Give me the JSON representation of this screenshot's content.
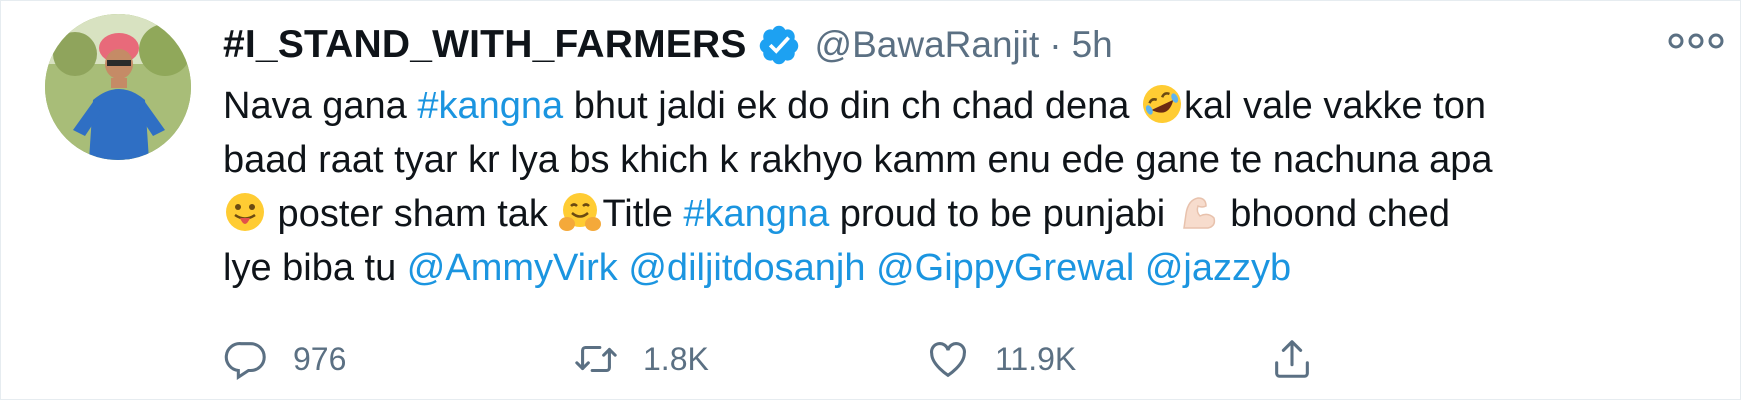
{
  "tweet": {
    "display_name": "#I_STAND_WITH_FARMERS",
    "handle": "@BawaRanjit",
    "separator": "·",
    "time": "5h",
    "text": {
      "l1_a": "Nava gana ",
      "l1_link": "#kangna",
      "l1_b": " bhut jaldi ek do din ch chad dena ",
      "l1_c": "kal vale vakke ton",
      "l2": "baad raat tyar kr lya bs khich k rakhyo kamm enu ede gane te nachuna apa",
      "l3_a": " poster sham tak ",
      "l3_b": "Title ",
      "l3_link": "#kangna",
      "l3_c": " proud to be punjabi ",
      "l3_d": " bhoond ched",
      "l4_a": "lye biba tu ",
      "mentions": [
        "@AmmyVirk",
        "@diljitdosanjh",
        "@GippyGrewal",
        "@jazzyb"
      ]
    },
    "actions": {
      "replies": "976",
      "retweets": "1.8K",
      "likes": "11.9K"
    }
  },
  "icons": {
    "verified": "verified-badge-icon",
    "more": "more-options-icon",
    "reply": "reply-icon",
    "retweet": "retweet-icon",
    "like": "heart-icon",
    "share": "share-icon"
  },
  "colors": {
    "link": "#1b95e0",
    "text": "#0f1419",
    "muted": "#5b7083",
    "verified": "#1da1f2"
  }
}
